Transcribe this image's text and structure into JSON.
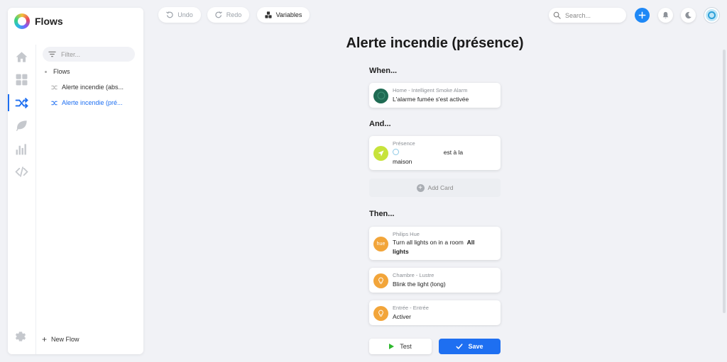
{
  "app": {
    "title": "Flows"
  },
  "sidebar": {
    "filter_placeholder": "Filter...",
    "rail": [
      {
        "name": "home-icon"
      },
      {
        "name": "dashboard-icon"
      },
      {
        "name": "flows-icon"
      },
      {
        "name": "leaf-icon"
      },
      {
        "name": "insights-icon"
      },
      {
        "name": "code-icon"
      }
    ],
    "tree": {
      "folder": "Flows",
      "items": [
        {
          "label": "Alerte incendie (abs..."
        },
        {
          "label": "Alerte incendie (pré..."
        }
      ]
    },
    "new_flow": "New Flow"
  },
  "toolbar": {
    "undo": "Undo",
    "redo": "Redo",
    "variables": "Variables",
    "search_placeholder": "Search..."
  },
  "flow": {
    "title": "Alerte incendie (présence)",
    "when_label": "When...",
    "and_label": "And...",
    "then_label": "Then...",
    "when_cards": [
      {
        "subtitle": "Home - Intelligent Smoke Alarm",
        "text": "L'alarme fumée s'est activée",
        "icon_color": "#1f6b53"
      }
    ],
    "and_cards": [
      {
        "subtitle": "Présence",
        "text_after": "est à la",
        "text_line2": "maison",
        "icon_color": "#c7e33b"
      }
    ],
    "add_card": "Add Card",
    "then_cards": [
      {
        "subtitle": "Philips Hue",
        "text": "Turn all lights on in a room",
        "bold": "All lights",
        "icon_label": "hue",
        "icon_color": "#f2a53a"
      },
      {
        "subtitle": "Chambre - Lustre",
        "text": "Blink the light (long)",
        "icon_color": "#f2a53a"
      },
      {
        "subtitle": "Entrée - Entrée",
        "text": "Activer",
        "icon_color": "#f2a53a"
      }
    ]
  },
  "actions": {
    "test": "Test",
    "save": "Save"
  },
  "colors": {
    "accent": "#1e6ff1",
    "background": "#f1f2f6"
  }
}
